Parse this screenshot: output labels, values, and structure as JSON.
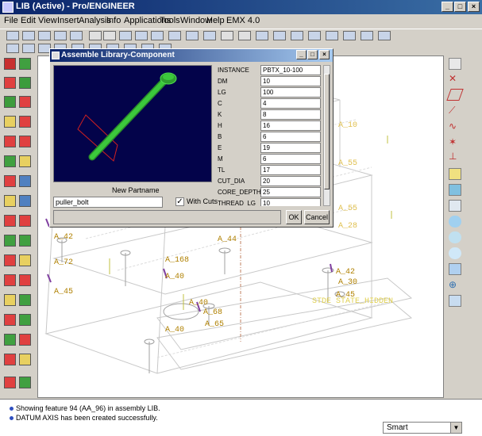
{
  "window": {
    "title": "LIB (Active) - Pro/ENGINEER"
  },
  "menubar": {
    "items": [
      "File",
      "Edit",
      "View",
      "Insert",
      "Analysis",
      "Info",
      "Applications",
      "Tools",
      "Window",
      "Help",
      "EMX 4.0"
    ]
  },
  "viewport": {
    "labels": [
      "A_55",
      "A_28",
      "A_42",
      "A_44",
      "A_72",
      "A_45",
      "A_168",
      "A_40",
      "A_42",
      "A_30",
      "A_45",
      "A_40",
      "A_68",
      "A_65",
      "A_40",
      "A_55",
      "A_10"
    ],
    "state_label": "STDE STATE_HIDDEN"
  },
  "dialog": {
    "title": "Assemble Library-Component",
    "partname_label": "New Partname",
    "partname_value": "puller_bolt",
    "with_cuts_label": "With Cuts",
    "with_cuts_checked": "✓",
    "ok_label": "OK",
    "cancel_label": "Cancel",
    "params": [
      {
        "name": "INSTANCE",
        "value": "PBTX_10-100"
      },
      {
        "name": "DM",
        "value": "10"
      },
      {
        "name": "LG",
        "value": "100"
      },
      {
        "name": "C",
        "value": "4"
      },
      {
        "name": "K",
        "value": "8"
      },
      {
        "name": "H",
        "value": "16"
      },
      {
        "name": "B",
        "value": "6"
      },
      {
        "name": "E",
        "value": "19"
      },
      {
        "name": "M",
        "value": "6"
      },
      {
        "name": "TL",
        "value": "17"
      },
      {
        "name": "CUT_DIA",
        "value": "20"
      },
      {
        "name": "CORE_DEPTH",
        "value": "25"
      },
      {
        "name": "THREAD_LG",
        "value": "10"
      }
    ]
  },
  "messages": [
    "Showing feature 94 (AA_96) in assembly LIB.",
    "DATUM AXIS has been created successfully."
  ],
  "filter": {
    "value": "Smart"
  },
  "colors": {
    "titlebar": "#0a246a",
    "viewport_bg": "#ffffff",
    "preview_bg": "#03034a",
    "bolt": "#3cc83c",
    "label": "#b08000"
  }
}
